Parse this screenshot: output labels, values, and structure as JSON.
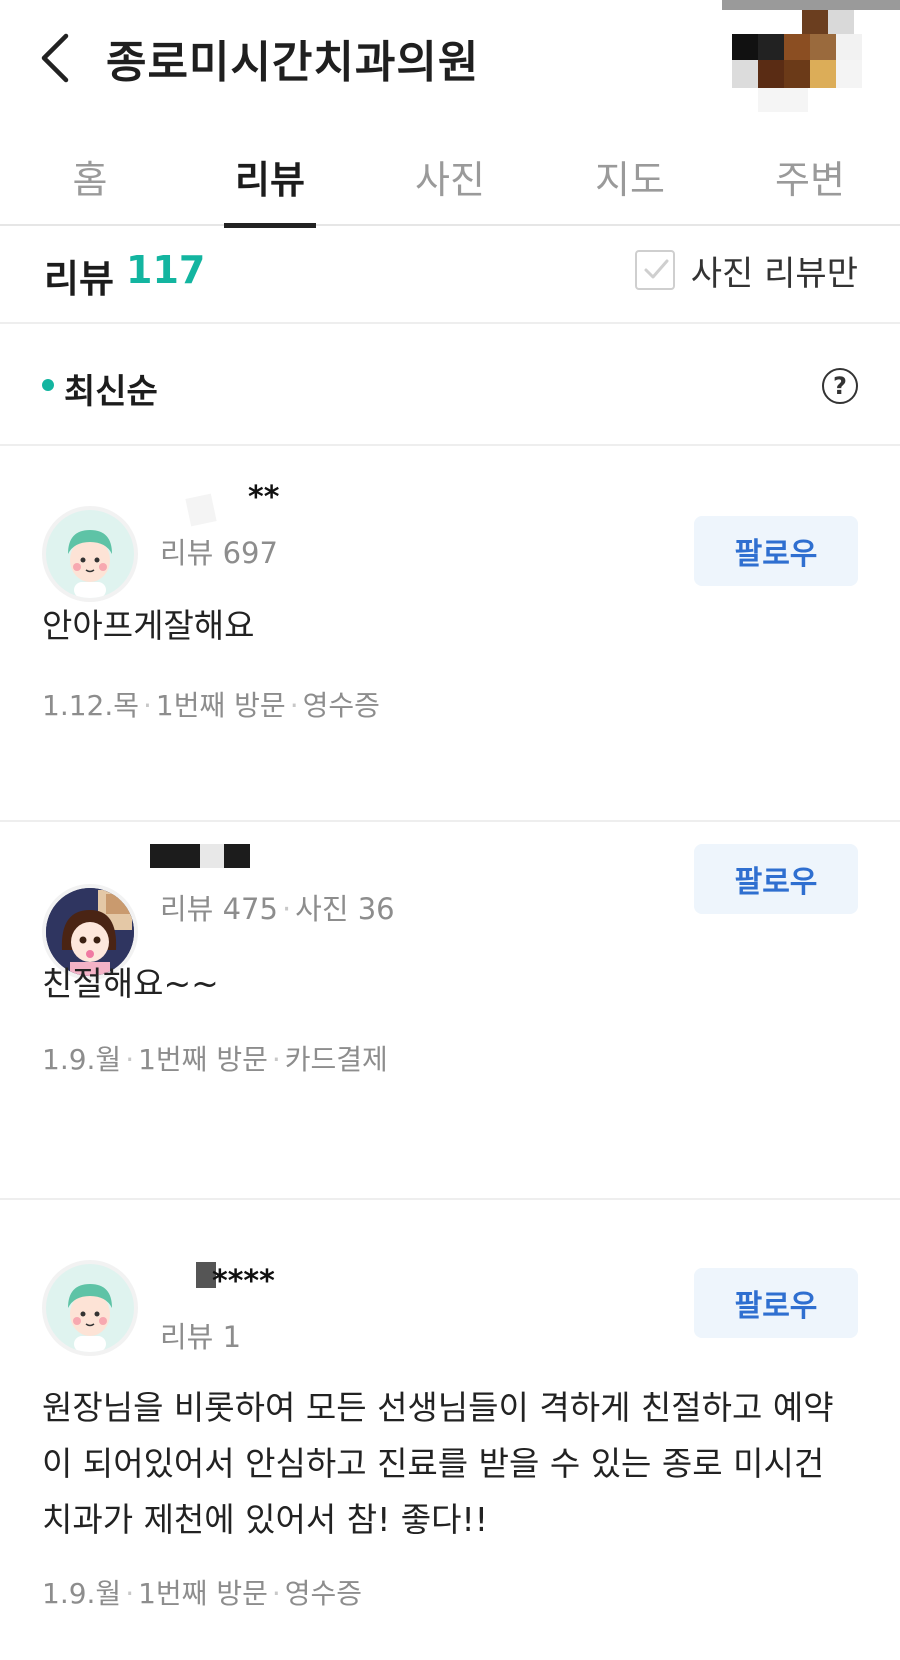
{
  "header": {
    "title": "종로미시간치과의원"
  },
  "tabs": [
    {
      "label": "홈",
      "active": false
    },
    {
      "label": "리뷰",
      "active": true
    },
    {
      "label": "사진",
      "active": false
    },
    {
      "label": "지도",
      "active": false
    },
    {
      "label": "주변",
      "active": false
    }
  ],
  "summary": {
    "label": "리뷰",
    "count": "117",
    "photo_filter_label": "사진 리뷰만"
  },
  "sort": {
    "label": "최신순",
    "help_glyph": "?"
  },
  "reviews": [
    {
      "name": "**",
      "stats": "리뷰 697",
      "follow_label": "팔로우",
      "text": "안아프게잘해요",
      "meta": {
        "date": "1.12.목",
        "visit": "1번째 방문",
        "payment": "영수증"
      }
    },
    {
      "name": "",
      "stats": "리뷰 475",
      "stats_extra": "사진 36",
      "follow_label": "팔로우",
      "text": "친절해요~~",
      "meta": {
        "date": "1.9.월",
        "visit": "1번째 방문",
        "payment": "카드결제"
      }
    },
    {
      "name": "****",
      "stats": "리뷰 1",
      "follow_label": "팔로우",
      "text": "원장님을 비롯하여 모든 선생님들이 격하게 친절하고 예약이 되어있어서 안심하고 진료를 받을 수 있는 종로 미시건 치과가 제천에 있어서 참! 좋다!!",
      "meta": {
        "date": "1.9.월",
        "visit": "1번째 방문",
        "payment": "영수증"
      }
    }
  ],
  "colors": {
    "accent": "#13b5a0",
    "follow_text": "#2f6fd0",
    "follow_bg": "#eef5fc"
  },
  "icons": {
    "back": "chevron-left-icon",
    "checkbox": "checkbox-icon",
    "help": "question-circle-icon"
  }
}
